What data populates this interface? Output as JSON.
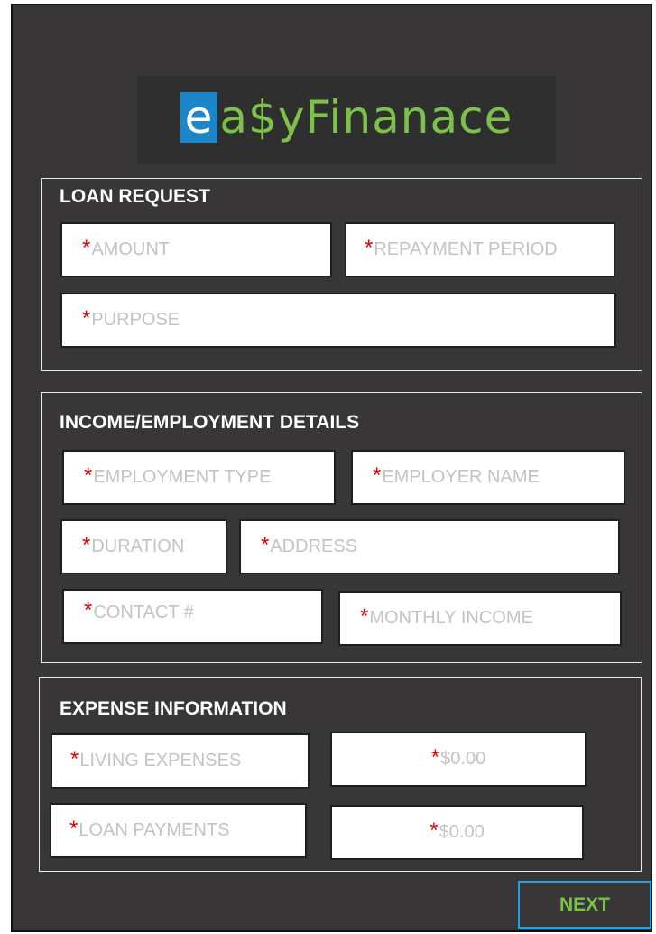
{
  "logo": {
    "first_letter": "e",
    "rest": "a$yFinanace"
  },
  "sections": {
    "loan": {
      "title": "LOAN REQUEST",
      "amount": "AMOUNT",
      "repayment_period": "REPAYMENT PERIOD",
      "purpose": "PURPOSE"
    },
    "employment": {
      "title": "INCOME/EMPLOYMENT DETAILS",
      "employment_type": "EMPLOYMENT TYPE",
      "employer_name": "EMPLOYER NAME",
      "duration": "DURATION",
      "address": "ADDRESS",
      "contact": "CONTACT #",
      "monthly_income": "MONTHLY INCOME"
    },
    "expense": {
      "title": "EXPENSE INFORMATION",
      "living_expenses": "LIVING EXPENSES",
      "living_expenses_amount": "$0.00",
      "loan_payments": "LOAN PAYMENTS",
      "loan_payments_amount": "$0.00"
    }
  },
  "required_marker": "*",
  "next_label": "NEXT",
  "colors": {
    "background": "#383636",
    "brand_blue": "#1c86c9",
    "brand_green": "#7cc24a",
    "required": "#e00000",
    "next_border": "#1aa3e8"
  }
}
